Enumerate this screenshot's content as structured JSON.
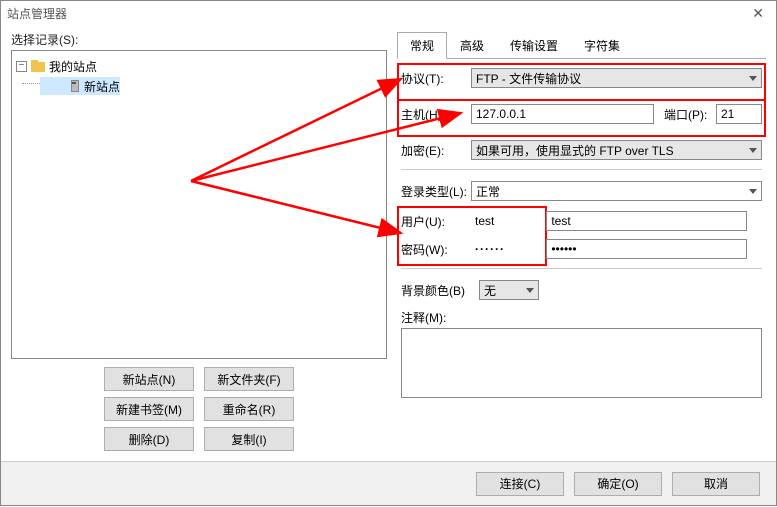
{
  "window": {
    "title": "站点管理器"
  },
  "left": {
    "select_record_label": "选择记录(S):",
    "root_label": "我的站点",
    "child_label": "新站点",
    "buttons": {
      "new_site": "新站点(N)",
      "new_folder": "新文件夹(F)",
      "new_bookmark": "新建书签(M)",
      "rename": "重命名(R)",
      "delete": "删除(D)",
      "copy": "复制(I)"
    }
  },
  "tabs": {
    "general": "常规",
    "advanced": "高级",
    "transfer": "传输设置",
    "charset": "字符集"
  },
  "form": {
    "protocol_label": "协议(T):",
    "protocol_value": "FTP - 文件传输协议",
    "host_label": "主机(H):",
    "host_value": "127.0.0.1",
    "port_label": "端口(P):",
    "port_value": "21",
    "encryption_label": "加密(E):",
    "encryption_value": "如果可用，使用显式的 FTP over TLS",
    "logon_type_label": "登录类型(L):",
    "logon_type_value": "正常",
    "user_label": "用户(U):",
    "user_value": "test",
    "password_label": "密码(W):",
    "password_value": "······",
    "bgcolor_label": "背景颜色(B)",
    "bgcolor_value": "无",
    "comments_label": "注释(M):"
  },
  "footer": {
    "connect": "连接(C)",
    "ok": "确定(O)",
    "cancel": "取消"
  }
}
